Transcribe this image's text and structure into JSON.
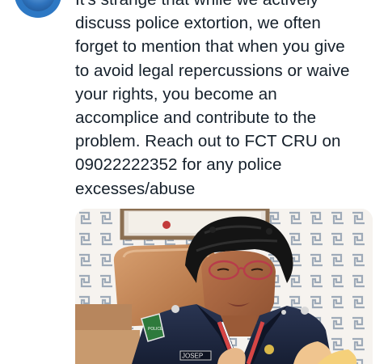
{
  "tweet": {
    "text_lines": [
      "It's strange that while we actively",
      "discuss police extortion, we often",
      "forget to mention that when you give",
      "to avoid legal repercussions or waive",
      "your rights, you become an",
      "accomplice and contribute to the",
      "problem. Reach out to FCT CRU on",
      "09022222352 for any police",
      "excesses/abuse"
    ],
    "photo": {
      "uniform_tag": "JOSEP",
      "shoulder_badge": "POLICE"
    }
  },
  "colors": {
    "text": "#15202b",
    "background": "#ffffff",
    "uniform": "#1f2a44",
    "avatar": "#2d78c4"
  }
}
